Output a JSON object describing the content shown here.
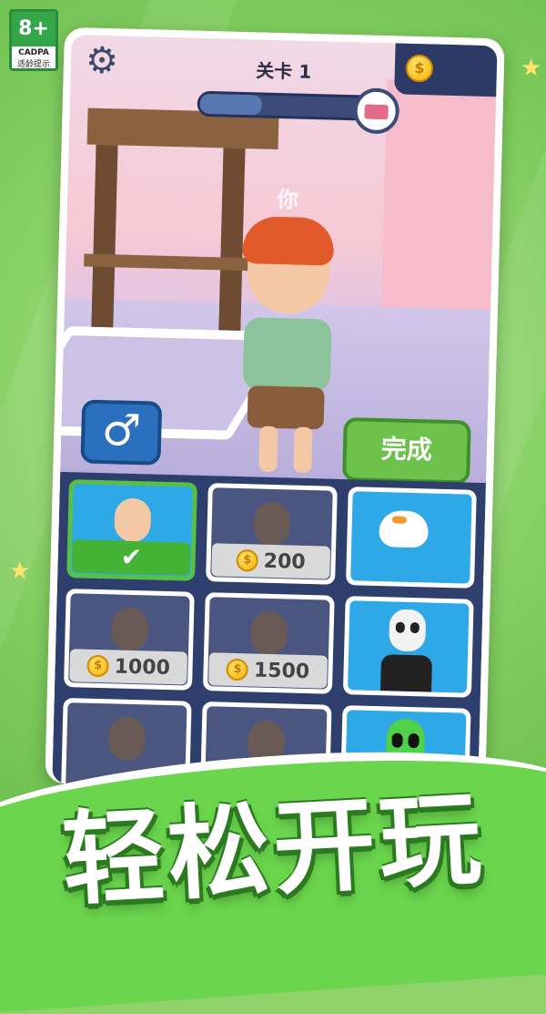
{
  "rating": {
    "age": "8+",
    "org": "CADPA",
    "tip": "适龄提示"
  },
  "hud": {
    "level_title": "关卡 1",
    "progress_fraction": 0.35,
    "settings_icon": "gear-icon",
    "currency_icon": "coin-icon"
  },
  "scene": {
    "player_label": "你"
  },
  "buttons": {
    "gender_icon": "♂",
    "done": "完成"
  },
  "skins": [
    {
      "id": "redhead",
      "state": "selected",
      "check": "✔"
    },
    {
      "id": "police",
      "state": "locked",
      "price": "200"
    },
    {
      "id": "goose",
      "state": "unlocked"
    },
    {
      "id": "pirate",
      "state": "locked",
      "price": "1000"
    },
    {
      "id": "knight",
      "state": "locked",
      "price": "1500"
    },
    {
      "id": "skeleton",
      "state": "unlocked"
    },
    {
      "id": "cowboy",
      "state": "locked"
    },
    {
      "id": "bearded",
      "state": "locked"
    },
    {
      "id": "alien",
      "state": "unlocked"
    }
  ],
  "slogan": "轻松开玩",
  "colors": {
    "accent_green": "#6bd64d",
    "panel_blue": "#2f3f6d",
    "coin_gold": "#f2b20a"
  }
}
